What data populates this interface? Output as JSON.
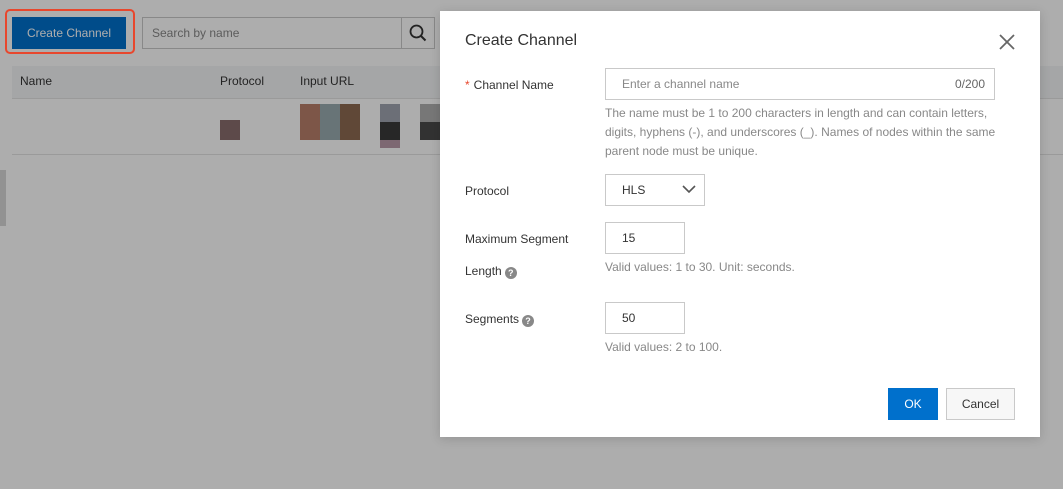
{
  "toolbar": {
    "create_label": "Create Channel",
    "search_placeholder": "Search by name",
    "search_icon": "search-icon"
  },
  "table": {
    "columns": [
      "Name",
      "Protocol",
      "Input URL"
    ]
  },
  "dialog": {
    "title": "Create Channel",
    "close_icon": "close-icon",
    "channel_name": {
      "required_mark": "*",
      "label": "Channel Name",
      "placeholder": "Enter a channel name",
      "counter": "0/200",
      "hint": "The name must be 1 to 200 characters in length and can contain letters, digits, hyphens (-), and underscores (_). Names of nodes within the same parent node must be unique."
    },
    "protocol": {
      "label": "Protocol",
      "value": "HLS"
    },
    "max_segment": {
      "label_line1": "Maximum Segment",
      "label_line2": "Length",
      "value": "15",
      "hint": "Valid values: 1 to 30. Unit: seconds."
    },
    "segments": {
      "label": "Segments",
      "value": "50",
      "hint": "Valid values: 2 to 100."
    },
    "ok_label": "OK",
    "cancel_label": "Cancel",
    "help_glyph": "?"
  },
  "colors": {
    "primary": "#0070cc",
    "highlight": "#e8472d"
  }
}
